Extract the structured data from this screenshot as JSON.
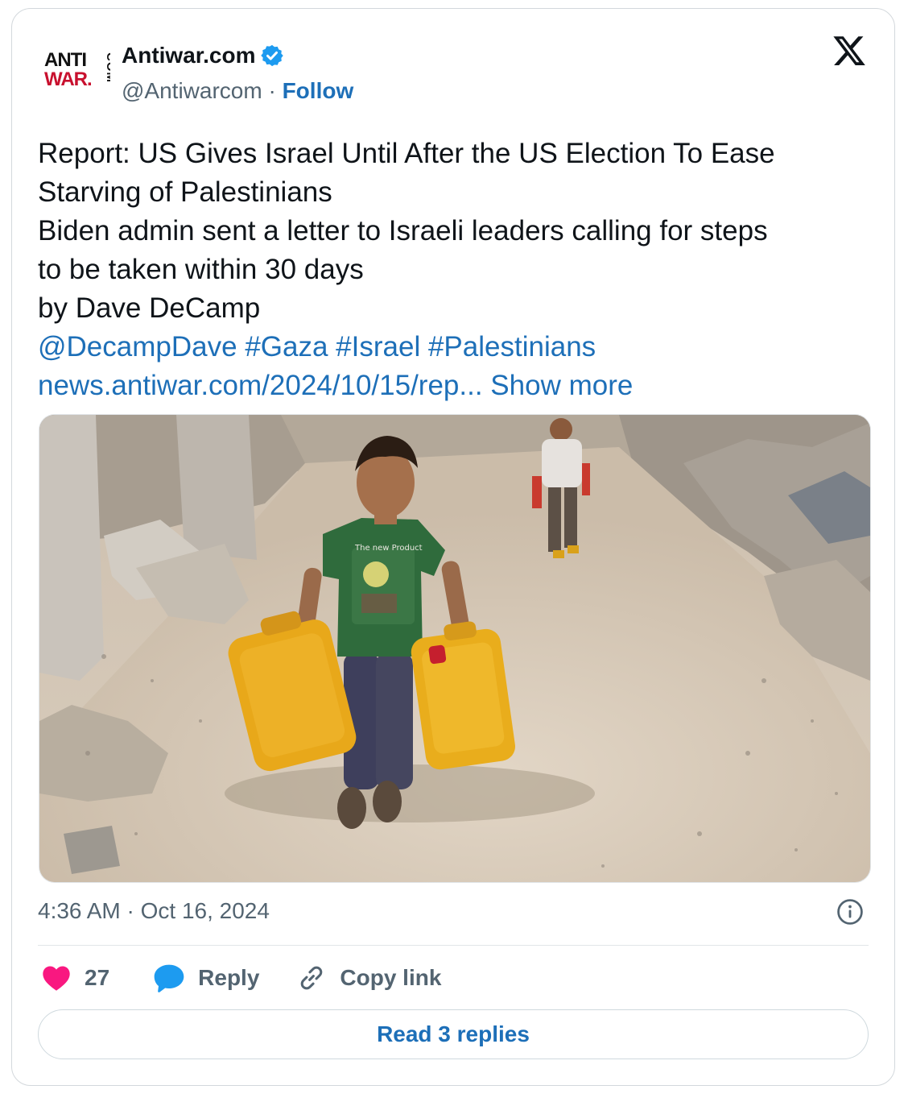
{
  "account": {
    "logo_text_top": "ANTI",
    "logo_text_bottom": "WAR.",
    "logo_text_vertical": "COM",
    "name": "Antiwar.com",
    "handle": "@Antiwarcom",
    "separator": "·",
    "follow_label": "Follow",
    "verified": true
  },
  "platform_icon": "x-logo-icon",
  "post": {
    "lines": [
      "Report: US Gives Israel Until After the US Election To Ease",
      "Starving of Palestinians",
      "Biden admin sent a letter to Israeli leaders calling for steps",
      "to be taken within 30 days",
      "by Dave DeCamp"
    ],
    "mention": "@DecampDave",
    "hashtags": [
      "#Gaza",
      "#Israel",
      "#Palestinians"
    ],
    "link": "news.antiwar.com/2024/10/15/rep...",
    "show_more": "Show more"
  },
  "media": {
    "kind": "photo",
    "subject": "child carrying two yellow water jerrycans on a dirt road between rubble",
    "shirt_text": "The new Product"
  },
  "timestamp": "4:36 AM · Oct 16, 2024",
  "actions": {
    "like_count": "27",
    "reply_label": "Reply",
    "copy_label": "Copy link"
  },
  "read_replies_label": "Read 3 replies",
  "colors": {
    "link": "#1d6fb8",
    "muted": "#536471",
    "heart": "#f91880",
    "reply_bubble": "#1d9bf0",
    "verified": "#1d9bf0"
  }
}
